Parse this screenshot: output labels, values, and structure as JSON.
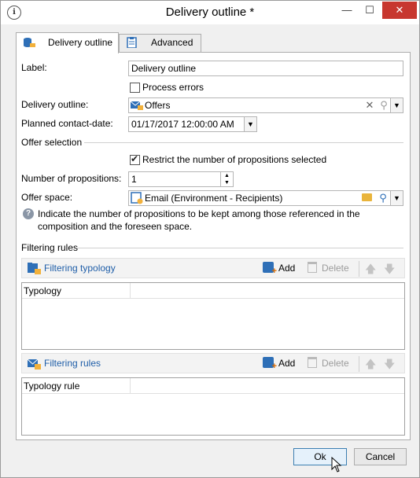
{
  "window": {
    "title": "Delivery outline *",
    "min_label": "—",
    "max_label": "☐",
    "close_label": "✕"
  },
  "tabs": [
    {
      "label": "Delivery outline",
      "active": true
    },
    {
      "label": "Advanced",
      "active": false
    }
  ],
  "form": {
    "label_label": "Label:",
    "label_value": "Delivery outline",
    "process_errors_label": "Process errors",
    "process_errors_checked": false,
    "delivery_outline_label": "Delivery outline:",
    "delivery_outline_value": "Offers",
    "planned_date_label": "Planned contact-date:",
    "planned_date_value": "01/17/2017 12:00:00 AM",
    "offer_selection_title": "Offer selection",
    "restrict_label": "Restrict the number of propositions selected",
    "restrict_checked": true,
    "num_propositions_label": "Number of propositions:",
    "num_propositions_value": "1",
    "offer_space_label": "Offer space:",
    "offer_space_value": "Email (Environment - Recipients)",
    "info_text_line1": "Indicate the number of propositions to be kept among those referenced in the",
    "info_text_line2": "composition and the foreseen space."
  },
  "filtering": {
    "section_title": "Filtering rules",
    "typology_toolbar": {
      "title": "Filtering typology",
      "add_label": "Add",
      "delete_label": "Delete"
    },
    "typology_grid": {
      "columns": [
        "Typology"
      ]
    },
    "rules_toolbar": {
      "title": "Filtering rules",
      "add_label": "Add",
      "delete_label": "Delete"
    },
    "rules_grid": {
      "columns": [
        "Typology rule"
      ]
    }
  },
  "footer": {
    "ok_label": "Ok",
    "cancel_label": "Cancel"
  },
  "colors": {
    "link_blue": "#1f5ea8",
    "close_red": "#c7372f",
    "ok_border": "#3c7fb1"
  }
}
